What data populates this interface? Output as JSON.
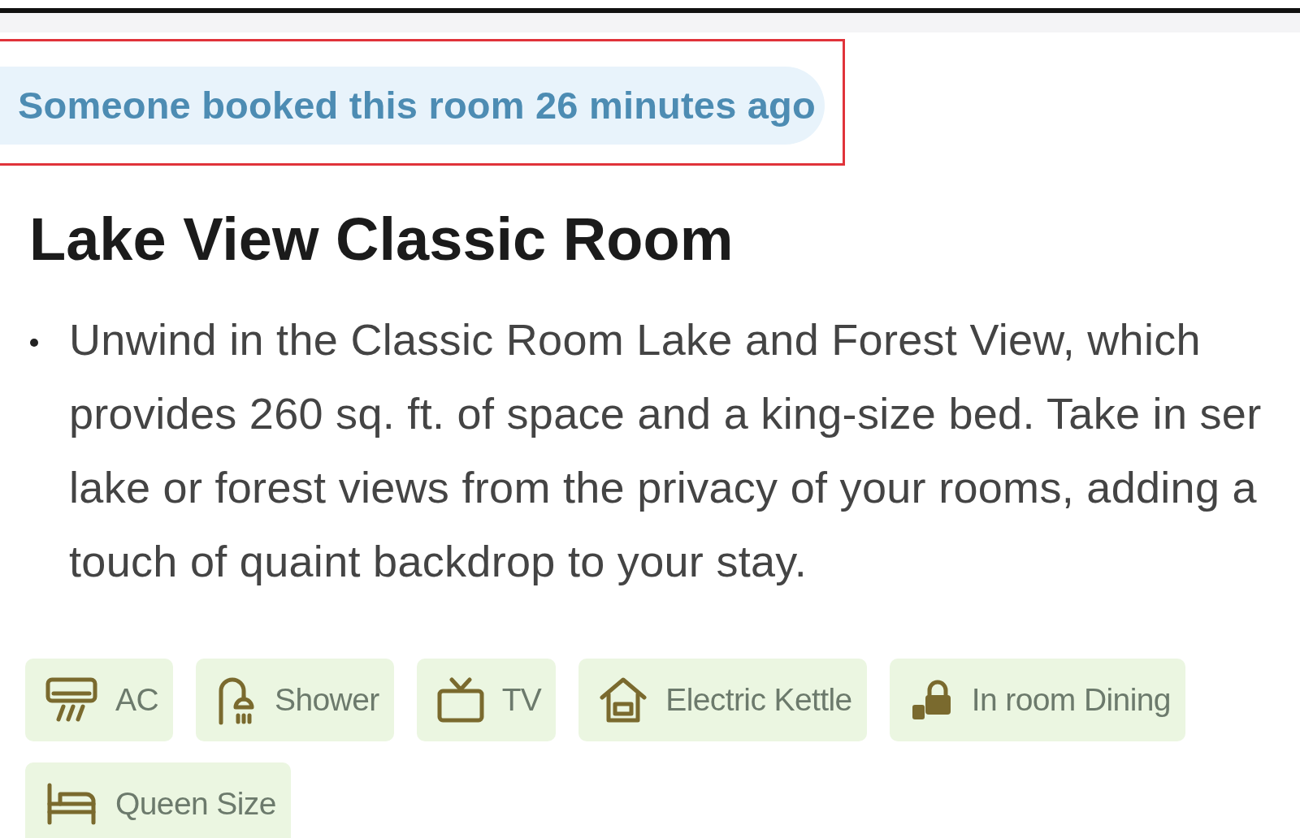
{
  "banner": {
    "text": "Someone booked this room 26 minutes ago"
  },
  "room": {
    "title": "Lake View Classic Room",
    "description": [
      {
        "lines": [
          "Unwind in the Classic Room Lake and Forest View, which",
          "provides 260 sq. ft. of space and a king-size bed. Take in ser",
          "lake or forest views from the privacy of your rooms, adding a",
          "touch of quaint backdrop to your stay."
        ]
      }
    ]
  },
  "amenities": [
    {
      "kind": "ac",
      "label": "AC"
    },
    {
      "kind": "shower",
      "label": "Shower"
    },
    {
      "kind": "tv",
      "label": "TV"
    },
    {
      "kind": "kettle",
      "label": "Electric Kettle"
    },
    {
      "kind": "dining",
      "label": "In room Dining"
    },
    {
      "kind": "bed",
      "label": "Queen Size"
    }
  ]
}
